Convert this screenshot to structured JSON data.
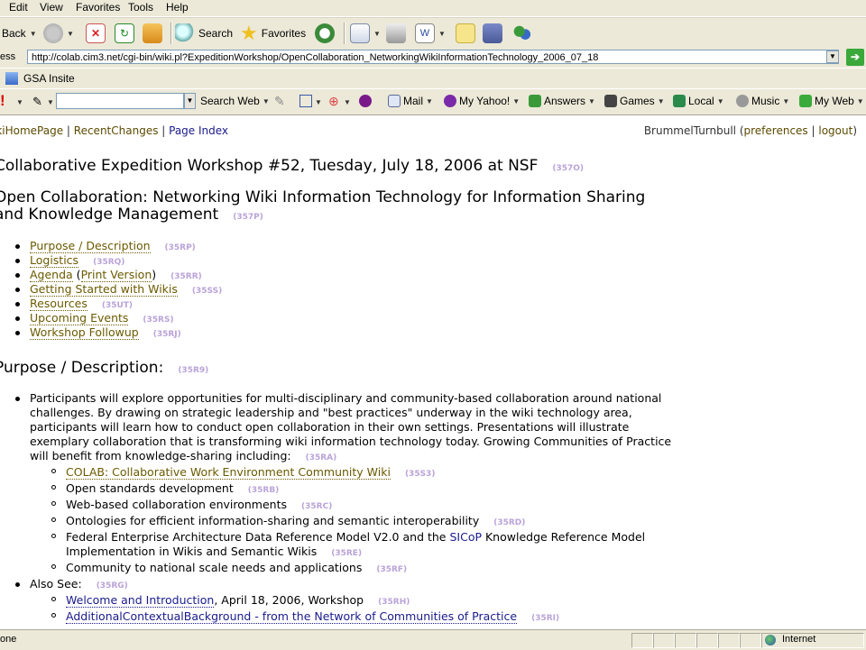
{
  "menu": [
    "Edit",
    "View",
    "Favorites",
    "Tools",
    "Help"
  ],
  "toolbar": {
    "back_label": "Back",
    "search_label": "Search",
    "favorites_label": "Favorites"
  },
  "address": {
    "label": "ess",
    "url": "http://colab.cim3.net/cgi-bin/wiki.pl?ExpeditionWorkshop/OpenCollaboration_NetworkingWikiInformationTechnology_2006_07_18"
  },
  "links": {
    "item": "GSA Insite"
  },
  "yahoo": {
    "search_button": "Search Web",
    "items": [
      "Mail",
      "My Yahoo!",
      "Answers",
      "Games",
      "Local",
      "Music",
      "My Web"
    ]
  },
  "nav": {
    "home": "ikiHomePage",
    "recent": "RecentChanges",
    "page_index": "Page Index",
    "user": "BrummelTurnbull",
    "preferences": "preferences",
    "logout": "logout"
  },
  "page": {
    "title": "Collaborative Expedition Workshop #52, Tuesday, July 18, 2006 at NSF",
    "title_nid": "(357O)",
    "subtitle_line1": "Open Collaboration: Networking Wiki Information Technology for Information Sharing",
    "subtitle_line2": "and Knowledge Management",
    "subtitle_nid": "(357P)"
  },
  "toc": [
    {
      "label": "Purpose / Description",
      "nid": "(35RP)"
    },
    {
      "label": "Logistics",
      "nid": "(35RQ)"
    },
    {
      "label": "Agenda",
      "extra": "Print Version",
      "nid": "(35RR)"
    },
    {
      "label": "Getting Started with Wikis",
      "nid": "(35SS)"
    },
    {
      "label": "Resources",
      "nid": "(35UT)"
    },
    {
      "label": "Upcoming Events",
      "nid": "(35RS)"
    },
    {
      "label": "Workshop Followup",
      "nid": "(35RJ)"
    }
  ],
  "purpose": {
    "heading": "Purpose / Description:",
    "heading_nid": "(35R9)",
    "paragraph": "Participants will explore opportunities for multi-disciplinary and community-based collaboration around national challenges. By drawing on strategic leadership and \"best practices\" underway in the wiki technology area, participants will learn how to conduct open collaboration in their own settings. Presentations will illustrate exemplary collaboration that is transforming wiki information technology today. Growing Communities of Practice will benefit from knowledge-sharing including:",
    "paragraph_nid": "(35RA)",
    "sub": [
      {
        "label": "COLAB: Collaborative Work Environment Community Wiki",
        "nid": "(35S3)"
      },
      {
        "label": "Open standards development",
        "nid": "(35RB)"
      },
      {
        "label": "Web-based collaboration environments",
        "nid": "(35RC)"
      },
      {
        "label": "Ontologies for efficient information-sharing and semantic interoperability",
        "nid": "(35RD)"
      },
      {
        "label_a": "Federal Enterprise Architecture Data Reference Model V2.0 and the ",
        "link": "SICoP",
        "label_b": " Knowledge Reference Model Implementation in Wikis and Semantic Wikis",
        "nid": "(35RE)"
      },
      {
        "label": "Community to national scale needs and applications",
        "nid": "(35RF)"
      }
    ],
    "also_see": "Also See:",
    "also_see_nid": "(35RG)",
    "also": [
      {
        "link": "Welcome and Introduction",
        "rest": ", April 18, 2006, Workshop",
        "nid": "(35RH)"
      },
      {
        "link": "AdditionalContextualBackground - from the Network of Communities of Practice",
        "nid": "(35RI)"
      }
    ]
  },
  "status": {
    "left": "one",
    "zone": "Internet"
  }
}
